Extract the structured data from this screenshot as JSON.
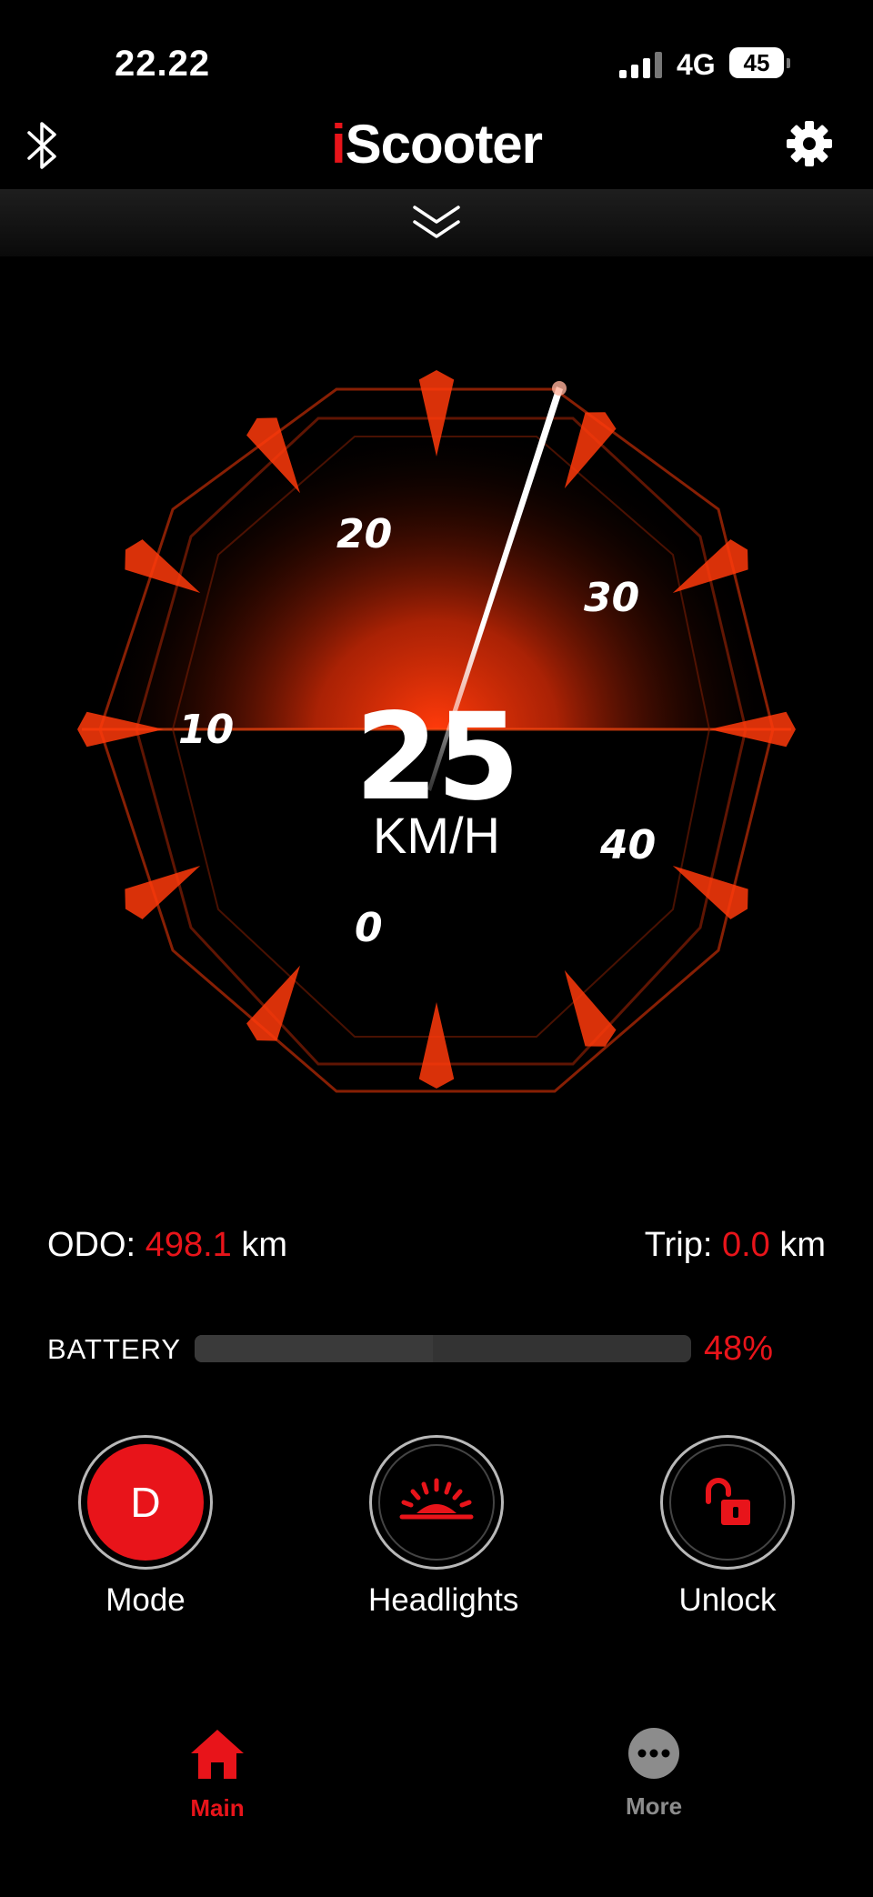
{
  "status_bar": {
    "time": "22.22",
    "network": "4G",
    "battery": "45"
  },
  "header": {
    "logo_prefix": "i",
    "logo_rest": "Scooter"
  },
  "gauge": {
    "speed": "25",
    "unit": "KM/H",
    "tick_labels": [
      "0",
      "10",
      "20",
      "30",
      "40"
    ],
    "accent_color": "#e8141a"
  },
  "stats": {
    "odo_label": "ODO:",
    "odo_value": "498.1",
    "odo_unit": "km",
    "trip_label": "Trip:",
    "trip_value": "0.0",
    "trip_unit": "km"
  },
  "battery": {
    "label": "BATTERY",
    "percent_text": "48%",
    "level": 0.48
  },
  "controls": {
    "mode": {
      "icon_text": "D",
      "label": "Mode"
    },
    "headlights": {
      "icon": "headlight-icon",
      "label": "Headlights"
    },
    "unlock": {
      "icon": "unlock-icon",
      "label": "Unlock"
    }
  },
  "tabs": [
    {
      "label": "Main",
      "icon": "home-icon",
      "active": true
    },
    {
      "label": "More",
      "icon": "more-icon",
      "active": false
    }
  ]
}
